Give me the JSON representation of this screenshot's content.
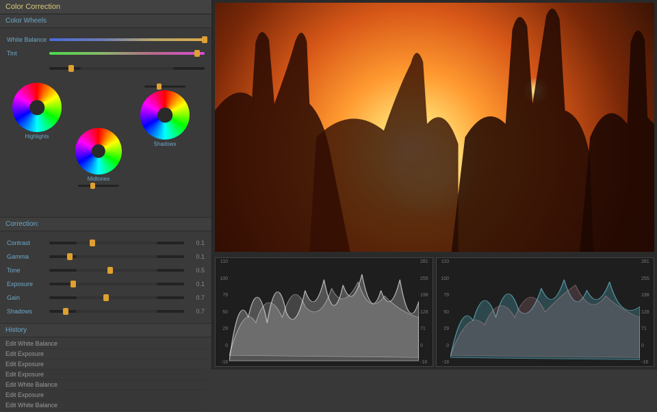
{
  "panel": {
    "title": "Color Correction",
    "wheels_title": "Color Wheels",
    "wb_label": "White Balance",
    "tint_label": "Tint",
    "wheel_hl": "Highlights",
    "wheel_mid": "Midtones",
    "wheel_sh": "Shadows",
    "correction_title": "Correction:",
    "sliders": [
      {
        "label": "Contrast",
        "value": "0.1",
        "pos": 32
      },
      {
        "label": "Gamma",
        "value": "0.1",
        "pos": 15
      },
      {
        "label": "Tone",
        "value": "0.5",
        "pos": 45
      },
      {
        "label": "Exposure",
        "value": "0.1",
        "pos": 18
      },
      {
        "label": "Gain",
        "value": "0.7",
        "pos": 42
      },
      {
        "label": "Shadows",
        "value": "0.7",
        "pos": 12
      }
    ],
    "history_title": "History",
    "history": [
      "Edit White Balance",
      "Edit Exposure",
      "Edit Exposure",
      "Edit Exposure",
      "Edit White Balance",
      "Edit Exposure",
      "Edit White Balance"
    ]
  },
  "scopes": {
    "ticks_left": [
      "110",
      "100",
      "79",
      "50",
      "29",
      "0",
      "-18"
    ],
    "ticks_right": [
      "281",
      "255",
      "198",
      "128",
      "71",
      "0",
      "-18"
    ]
  }
}
